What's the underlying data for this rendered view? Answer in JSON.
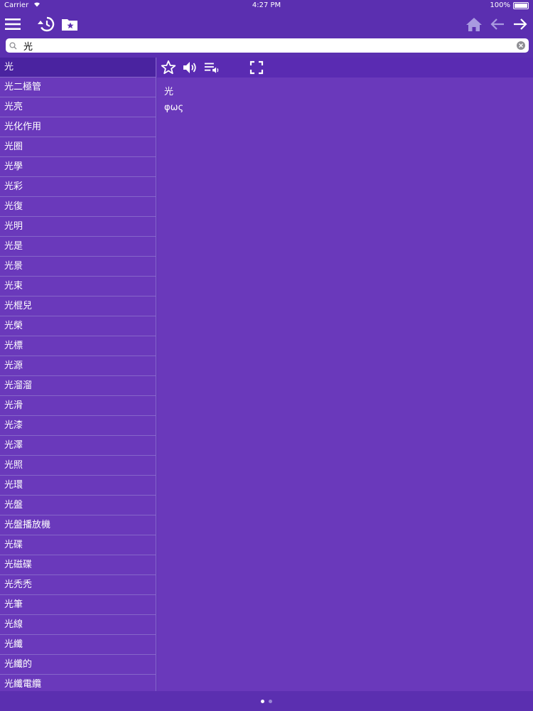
{
  "status": {
    "carrier": "Carrier",
    "time": "4:27 PM",
    "battery": "100%"
  },
  "toolbar": {
    "icons": [
      "menu-icon",
      "history-icon",
      "favorites-folder-icon",
      "home-icon",
      "back-arrow-icon",
      "forward-arrow-icon"
    ]
  },
  "search": {
    "value": "光",
    "placeholder": ""
  },
  "word_list": [
    "光",
    "光二極管",
    "光亮",
    "光化作用",
    "光圈",
    "光學",
    "光彩",
    "光復",
    "光明",
    "光是",
    "光景",
    "光束",
    "光棍兒",
    "光榮",
    "光標",
    "光源",
    "光溜溜",
    "光滑",
    "光漆",
    "光澤",
    "光照",
    "光環",
    "光盤",
    "光盤播放機",
    "光碟",
    "光磁碟",
    "光禿禿",
    "光筆",
    "光線",
    "光纖",
    "光纖的",
    "光纖電纜"
  ],
  "selected_index": 0,
  "detail": {
    "word": "光",
    "translation": "φως",
    "icons": [
      "star-icon",
      "speaker-icon",
      "playlist-audio-icon",
      "fullscreen-icon"
    ]
  },
  "colors": {
    "background": "#5b2fb0",
    "panel": "#6a39bb",
    "selected": "#4a23a0"
  }
}
